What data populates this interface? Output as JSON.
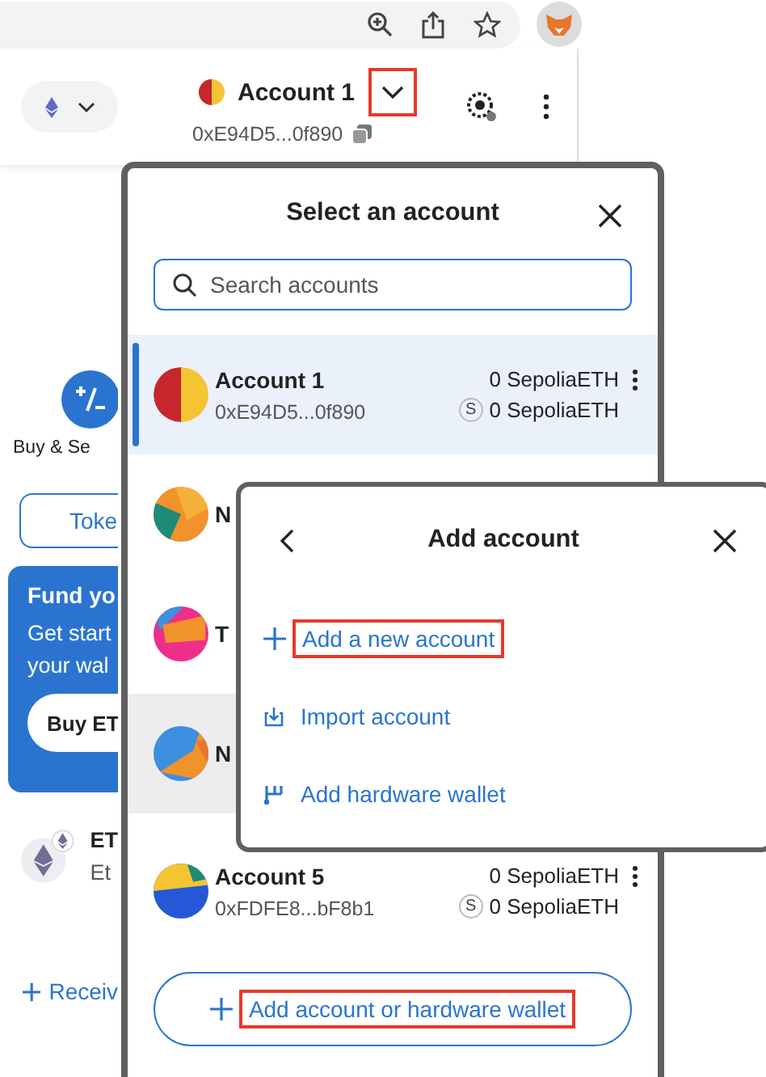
{
  "header": {
    "account_name": "Account 1",
    "address": "0xE94D5...0f890",
    "dropdown_highlighted": true
  },
  "background": {
    "buy_sell_label": "Buy & Se",
    "tab_label": "Toke",
    "fund_card": {
      "title": "Fund yo",
      "lines": [
        "Get start",
        "your wal"
      ],
      "button": "Buy ET"
    },
    "asset": {
      "name": "ET",
      "subtitle": "Et"
    },
    "receive_link": "Receiv"
  },
  "account_modal": {
    "title": "Select an account",
    "search": {
      "placeholder": "Search accounts"
    },
    "accounts": [
      {
        "name": "Account 1",
        "address": "0xE94D5...0f890",
        "balance": "0 SepoliaETH",
        "badge": "S",
        "secondary_balance": "0 SepoliaETH",
        "selected": true,
        "hovered": false
      },
      {
        "name": "N",
        "selected": false,
        "hovered": false
      },
      {
        "name": "T",
        "selected": false,
        "hovered": false
      },
      {
        "name": "N",
        "selected": false,
        "hovered": true
      },
      {
        "name": "Account 5",
        "address": "0xFDFE8...bF8b1",
        "balance": "0 SepoliaETH",
        "badge": "S",
        "secondary_balance": "0 SepoliaETH",
        "selected": false,
        "hovered": false
      }
    ],
    "add_button": {
      "label": "Add account or hardware wallet",
      "highlighted": true
    }
  },
  "add_account_modal": {
    "title": "Add account",
    "options": [
      {
        "kind": "new",
        "label": "Add a new account",
        "highlighted": true
      },
      {
        "kind": "import",
        "label": "Import account",
        "highlighted": false
      },
      {
        "kind": "hardware",
        "label": "Add hardware wallet",
        "highlighted": false
      }
    ]
  }
}
